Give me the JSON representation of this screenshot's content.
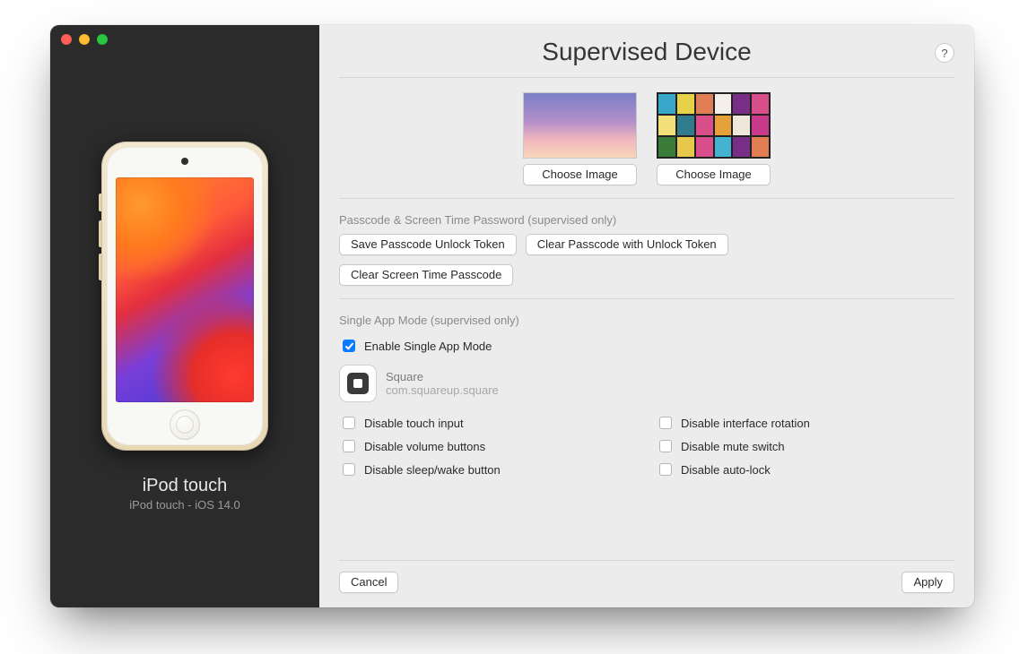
{
  "sidebar": {
    "device_name": "iPod touch",
    "device_detail": "iPod touch - iOS 14.0"
  },
  "header": {
    "title": "Supervised Device",
    "help_tooltip": "?"
  },
  "wallpapers": {
    "choose_label_left": "Choose Image",
    "choose_label_right": "Choose Image"
  },
  "passcode_section": {
    "label": "Passcode & Screen Time Password (supervised only)",
    "save_token_btn": "Save Passcode Unlock Token",
    "clear_with_token_btn": "Clear Passcode with Unlock Token",
    "clear_screentime_btn": "Clear Screen Time Passcode"
  },
  "single_app_section": {
    "label": "Single App Mode (supervised only)",
    "enable_label": "Enable Single App Mode",
    "enable_checked": true,
    "app_name": "Square",
    "app_bundle": "com.squareup.square",
    "options": [
      {
        "key": "disable_touch",
        "label": "Disable touch input",
        "checked": false
      },
      {
        "key": "disable_rotation",
        "label": "Disable interface rotation",
        "checked": false
      },
      {
        "key": "disable_volume",
        "label": "Disable volume buttons",
        "checked": false
      },
      {
        "key": "disable_mute",
        "label": "Disable mute switch",
        "checked": false
      },
      {
        "key": "disable_sleepwake",
        "label": "Disable sleep/wake button",
        "checked": false
      },
      {
        "key": "disable_autolock",
        "label": "Disable auto-lock",
        "checked": false
      }
    ]
  },
  "footer": {
    "cancel": "Cancel",
    "apply": "Apply"
  }
}
